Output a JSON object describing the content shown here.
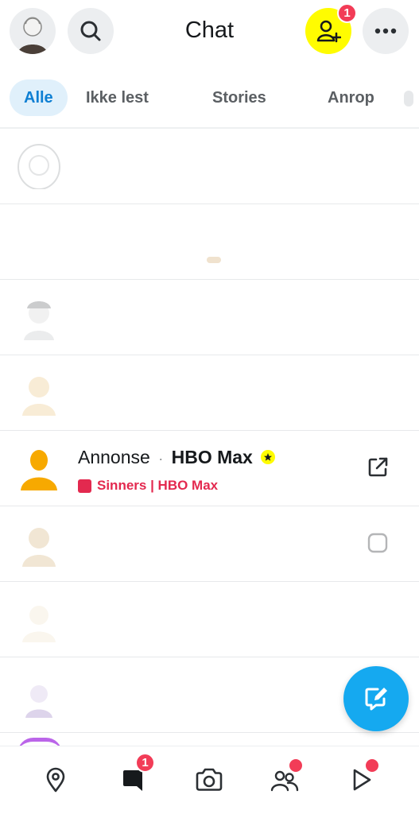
{
  "header": {
    "title": "Chat",
    "add_friend_badge": "1",
    "icons": [
      "profile-avatar",
      "search-icon",
      "add-friend-icon",
      "more-icon"
    ]
  },
  "tabs": [
    {
      "label": "Alle",
      "active": true
    },
    {
      "label": "Ikke lest",
      "active": false
    },
    {
      "label": "Stories",
      "active": false
    },
    {
      "label": "Anrop",
      "active": false
    }
  ],
  "ad_row": {
    "prefix": "Annonse",
    "separator": "·",
    "brand": "HBO Max",
    "subtitle": "Sinners | HBO Max",
    "accent": "#e3294f"
  },
  "bottom_nav": {
    "chat_badge": "1",
    "items": [
      "map-icon",
      "chat-icon",
      "camera-icon",
      "friends-icon",
      "stories-icon"
    ]
  },
  "colors": {
    "snap_yellow": "#fffc00",
    "tab_active_bg": "#e0f0fb",
    "tab_active_text": "#0e7fd3",
    "fab": "#15a9f0",
    "badge": "#f23c57",
    "bitmoji_orange": "#f7a900"
  }
}
